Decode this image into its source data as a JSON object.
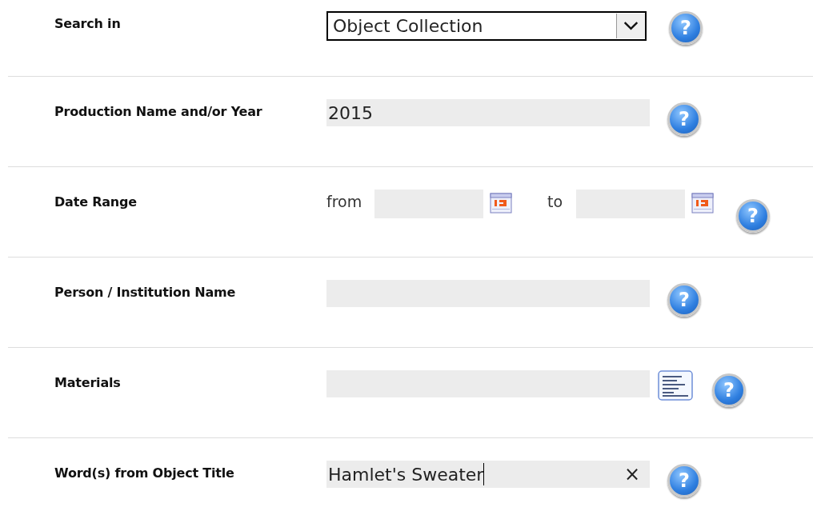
{
  "form": {
    "rows": [
      {
        "kind": "select",
        "label": "Search in",
        "value": "Object Collection",
        "help": "?"
      },
      {
        "kind": "text",
        "label": "Production Name and/or Year",
        "value": "2015",
        "help": "?"
      },
      {
        "kind": "daterange",
        "label": "Date Range",
        "from_label": "from",
        "to_label": "to",
        "help": "?"
      },
      {
        "kind": "text",
        "label": "Person / Institution Name",
        "help": "?"
      },
      {
        "kind": "lookup",
        "label": "Materials",
        "help": "?"
      },
      {
        "kind": "text",
        "label": "Word(s) from Object Title",
        "value": "Hamlet's Sweater",
        "clear": "×",
        "focused": true,
        "help": "?"
      }
    ]
  }
}
